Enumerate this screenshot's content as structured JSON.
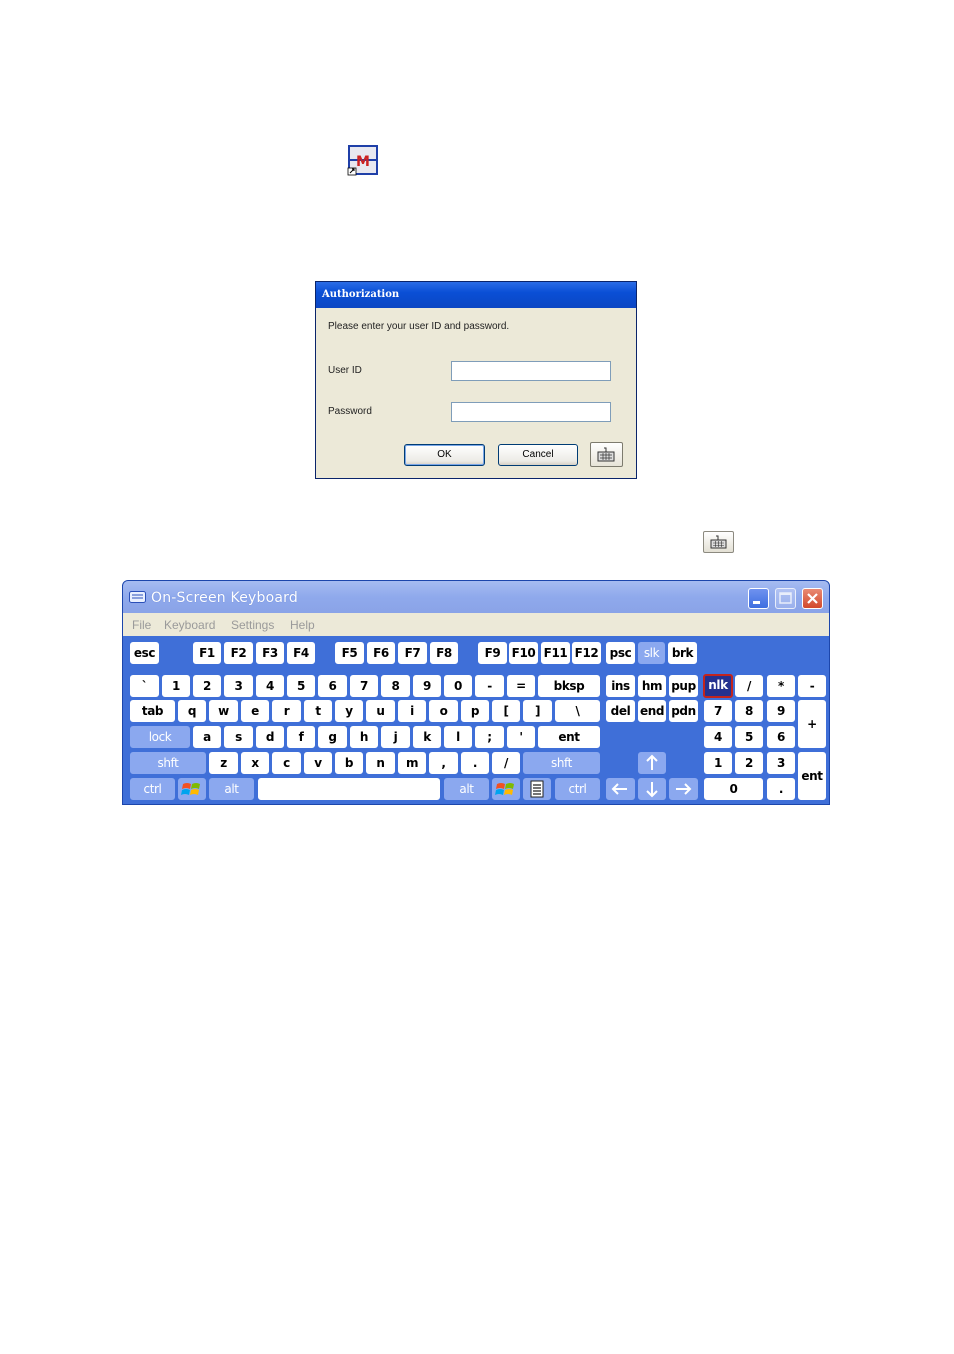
{
  "shortcut": {
    "icon": "cms-app-icon"
  },
  "auth": {
    "title": "Authorization",
    "prompt": "Please enter your user ID and password.",
    "user_label": "User ID",
    "user_value": "",
    "password_label": "Password",
    "password_value": "",
    "ok_label": "OK",
    "cancel_label": "Cancel",
    "keyboard_icon": "keyboard-icon"
  },
  "osk": {
    "title": "On-Screen Keyboard",
    "menu": [
      "File",
      "Keyboard",
      "Settings",
      "Help"
    ],
    "colors": {
      "frame": "#3f6fd8",
      "modifier": "#8ba8ef",
      "active_key": "#24318f",
      "active_border": "#c2241d"
    },
    "keys": {
      "esc": "esc",
      "f1": "F1",
      "f2": "F2",
      "f3": "F3",
      "f4": "F4",
      "f5": "F5",
      "f6": "F6",
      "f7": "F7",
      "f8": "F8",
      "f9": "F9",
      "f10": "F10",
      "f11": "F11",
      "f12": "F12",
      "psc": "psc",
      "slk": "slk",
      "brk": "brk",
      "backtick": "`",
      "k1": "1",
      "k2": "2",
      "k3": "3",
      "k4": "4",
      "k5": "5",
      "k6": "6",
      "k7": "7",
      "k8": "8",
      "k9": "9",
      "k0": "0",
      "minus": "-",
      "equals": "=",
      "bksp": "bksp",
      "ins": "ins",
      "hm": "hm",
      "pup": "pup",
      "nlk": "nlk",
      "num_div": "/",
      "num_mul": "*",
      "num_sub": "-",
      "tab": "tab",
      "q": "q",
      "w": "w",
      "e": "e",
      "r": "r",
      "t": "t",
      "y": "y",
      "u": "u",
      "i": "i",
      "o": "o",
      "p": "p",
      "lbracket": "[",
      "rbracket": "]",
      "backslash": "\\",
      "del": "del",
      "end": "end",
      "pdn": "pdn",
      "n7": "7",
      "n8": "8",
      "n9": "9",
      "num_add": "+",
      "lock": "lock",
      "a": "a",
      "s": "s",
      "d": "d",
      "f": "f",
      "g": "g",
      "h": "h",
      "j": "j",
      "k": "k",
      "l": "l",
      "semicolon": ";",
      "quote": "'",
      "ent": "ent",
      "n4": "4",
      "n5": "5",
      "n6": "6",
      "lshft": "shft",
      "z": "z",
      "x": "x",
      "c": "c",
      "v": "v",
      "b": "b",
      "n": "n",
      "m": "m",
      "comma": ",",
      "period": ".",
      "slash": "/",
      "rshft": "shft",
      "n1": "1",
      "n2": "2",
      "n3": "3",
      "num_ent": "ent",
      "lctrl": "ctrl",
      "lalt": "alt",
      "space": "",
      "ralt": "alt",
      "rctrl": "ctrl",
      "n0": "0",
      "num_dot": "."
    }
  }
}
